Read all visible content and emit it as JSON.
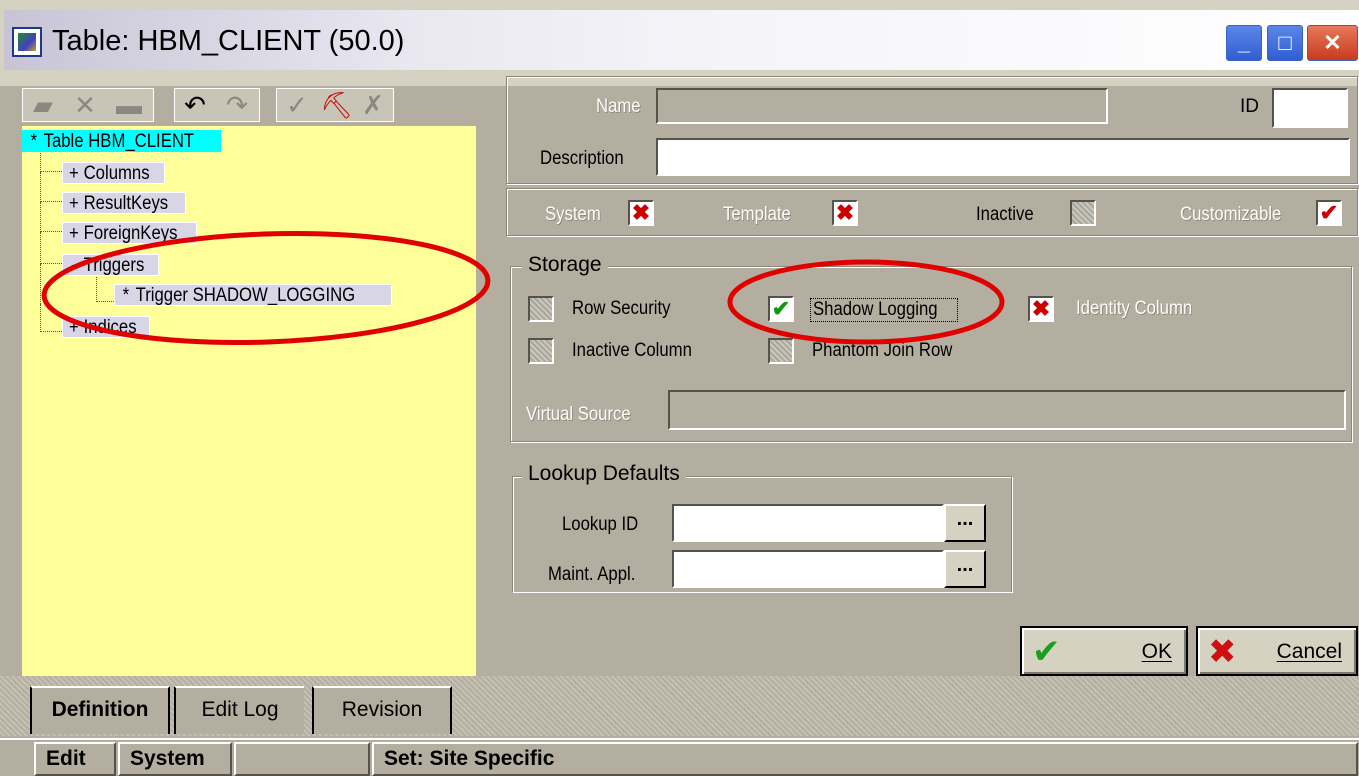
{
  "window": {
    "title": "Table: HBM_CLIENT (50.0)",
    "controls": {
      "minimize": "_",
      "maximize": "□",
      "close": "✕"
    }
  },
  "toolbar": {
    "icons": [
      "new-icon",
      "delete-icon",
      "folder-icon",
      "undo-icon",
      "redo-icon",
      "brush-icon",
      "pickaxe-icon",
      "tools-icon"
    ]
  },
  "tree": {
    "root": {
      "marker": "*",
      "label": "Table HBM_CLIENT"
    },
    "children": [
      {
        "marker": "+",
        "label": "Columns"
      },
      {
        "marker": "+",
        "label": "ResultKeys"
      },
      {
        "marker": "+",
        "label": "ForeignKeys"
      },
      {
        "marker": "-",
        "label": "Triggers"
      },
      {
        "marker": "*",
        "label": "Trigger SHADOW_LOGGING"
      },
      {
        "marker": "+",
        "label": "Indices"
      }
    ]
  },
  "form": {
    "name_label": "Name",
    "name_value": "",
    "id_label": "ID",
    "id_value": "",
    "description_label": "Description",
    "description_value": "",
    "flags": {
      "system": {
        "label": "System",
        "state": "x"
      },
      "template": {
        "label": "Template",
        "state": "x"
      },
      "inactive": {
        "label": "Inactive",
        "state": "gray"
      },
      "customizable": {
        "label": "Customizable",
        "state": "check"
      }
    }
  },
  "storage": {
    "legend": "Storage",
    "row_security": {
      "label": "Row Security",
      "state": "gray"
    },
    "shadow_logging": {
      "label": "Shadow Logging",
      "state": "check"
    },
    "identity_column": {
      "label": "Identity Column",
      "state": "x"
    },
    "inactive_column": {
      "label": "Inactive Column",
      "state": "gray"
    },
    "phantom_join_row": {
      "label": "Phantom Join Row",
      "state": "gray"
    },
    "virtual_source_label": "Virtual Source",
    "virtual_source_value": ""
  },
  "lookup": {
    "legend": "Lookup Defaults",
    "lookup_id_label": "Lookup ID",
    "lookup_id_value": "",
    "maint_appl_label": "Maint. Appl.",
    "maint_appl_value": "",
    "ellipsis": "..."
  },
  "buttons": {
    "ok": "OK",
    "cancel": "Cancel"
  },
  "tabs": [
    "Definition",
    "Edit Log",
    "Revision"
  ],
  "statusbar": {
    "edit": "Edit",
    "system": "System",
    "empty": "",
    "set": "Set: Site Specific"
  },
  "colors": {
    "tree_bg": "#ffff99",
    "selection": "#00ffff",
    "annotation": "#e00000"
  }
}
